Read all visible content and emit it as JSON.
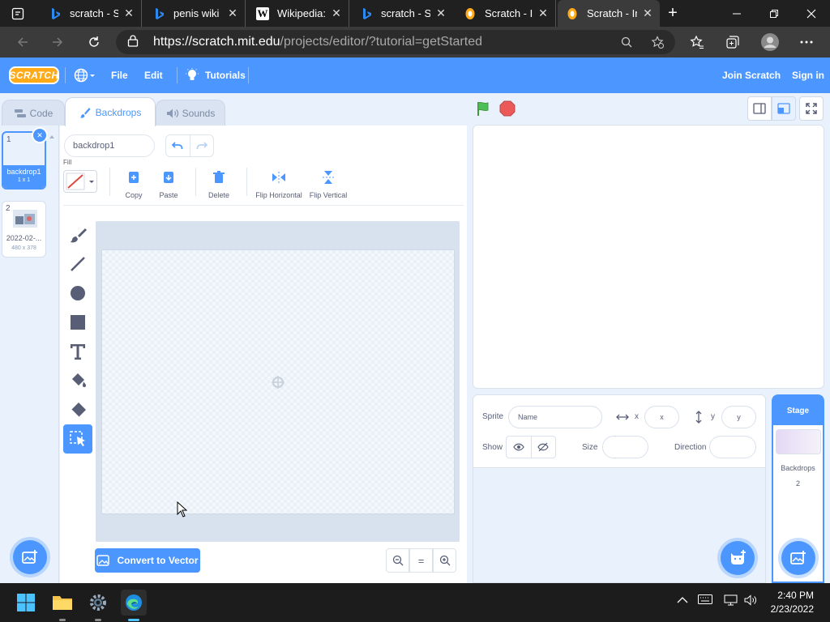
{
  "browser": {
    "tabs": [
      {
        "title": "",
        "icon": "tab-actions-icon"
      },
      {
        "title": "scratch - Se",
        "icon": "bing-icon"
      },
      {
        "title": "penis wiki -",
        "icon": "bing-icon"
      },
      {
        "title": "Wikipedia:A",
        "icon": "wikipedia-icon"
      },
      {
        "title": "scratch - Se",
        "icon": "bing-icon"
      },
      {
        "title": "Scratch - Im",
        "icon": "scratch-icon"
      },
      {
        "title": "Scratch - Im",
        "icon": "scratch-icon"
      }
    ],
    "close_glyph": "✕",
    "new_tab_glyph": "+",
    "url_host": "https://scratch.mit.edu",
    "url_path": "/projects/editor/?tutorial=getStarted"
  },
  "menubar": {
    "logo": "SCRATCH",
    "file": "File",
    "edit": "Edit",
    "tutorials": "Tutorials",
    "join": "Join Scratch",
    "signin": "Sign in"
  },
  "editor_tabs": {
    "code": "Code",
    "backdrops": "Backdrops",
    "sounds": "Sounds"
  },
  "costumes": [
    {
      "num": "1",
      "name": "backdrop1",
      "size": "1 x 1"
    },
    {
      "num": "2",
      "name": "2022-02-...",
      "size": "480 x 378"
    }
  ],
  "paint": {
    "costume_name": "backdrop1",
    "fill_label": "Fill",
    "copy": "Copy",
    "paste": "Paste",
    "delete": "Delete",
    "flip_h": "Flip Horizontal",
    "flip_v": "Flip Vertical",
    "convert": "Convert to Vector",
    "zoom_reset": "="
  },
  "sprite_info": {
    "sprite_label": "Sprite",
    "name_placeholder": "Name",
    "x_label": "x",
    "x_placeholder": "x",
    "y_label": "y",
    "y_placeholder": "y",
    "show_label": "Show",
    "size_label": "Size",
    "direction_label": "Direction"
  },
  "stage_panel": {
    "title": "Stage",
    "backdrops_label": "Backdrops",
    "backdrops_count": "2"
  },
  "taskbar": {
    "time": "2:40 PM",
    "date": "2/23/2022"
  },
  "colors": {
    "scratch_blue": "#4c97ff",
    "logo_orange": "#ffab19",
    "green_flag": "#4cbf56",
    "stop": "#ec5959"
  }
}
